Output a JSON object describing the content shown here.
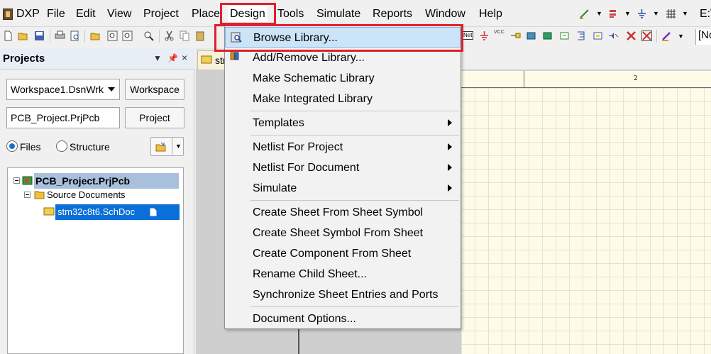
{
  "app": {
    "name": "DXP"
  },
  "menubar": {
    "items": [
      "DXP",
      "File",
      "Edit",
      "View",
      "Project",
      "Place",
      "Design",
      "Tools",
      "Simulate",
      "Reports",
      "Window",
      "Help"
    ],
    "right_text": "E:\\",
    "doc_selector_text": "[No"
  },
  "toolbar": {
    "net_label": "Net",
    "vcc_label": "VCC"
  },
  "panel": {
    "title": "Projects",
    "workspace_value": "Workspace1.DsnWrk",
    "workspace_button": "Workspace",
    "project_value": "PCB_Project.PrjPcb",
    "project_button": "Project",
    "radio_files": "Files",
    "radio_structure": "Structure",
    "files_selected": true
  },
  "tree": {
    "project": "PCB_Project.PrjPcb",
    "folder": "Source Documents",
    "document": "stm32c8t6.SchDoc"
  },
  "document": {
    "tab_text": "str",
    "ruler_label": "2"
  },
  "design_menu": {
    "browse_library": "Browse Library...",
    "add_remove_library": "Add/Remove Library...",
    "make_schematic_library": "Make Schematic Library",
    "make_integrated_library": "Make Integrated Library",
    "templates": "Templates",
    "netlist_for_project": "Netlist For Project",
    "netlist_for_document": "Netlist For Document",
    "simulate": "Simulate",
    "create_sheet_from_symbol": "Create Sheet From Sheet Symbol",
    "create_symbol_from_sheet": "Create Sheet Symbol From Sheet",
    "create_component_from_sheet": "Create Component From Sheet",
    "rename_child_sheet": "Rename Child Sheet...",
    "synchronize_sheet_entries": "Synchronize Sheet Entries and Ports",
    "document_options": "Document Options..."
  },
  "colors": {
    "highlight": "#cce4f7",
    "annotation_red": "#e0202a",
    "tree_selected": "#0a6fd8"
  }
}
